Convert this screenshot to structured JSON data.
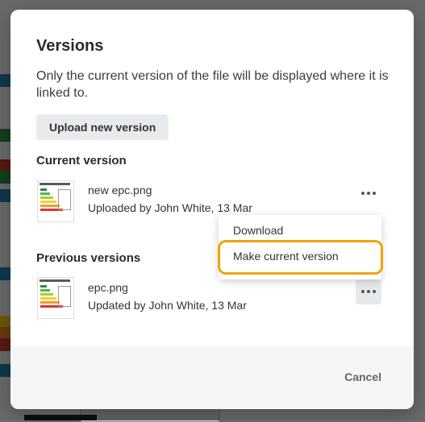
{
  "modal": {
    "title": "Versions",
    "description": "Only the current version of the file will be displayed where it is linked to.",
    "upload_button": "Upload new version",
    "current_section": "Current version",
    "previous_section": "Previous versions",
    "cancel_button": "Cancel"
  },
  "current_version": {
    "file_name": "new epc.png",
    "meta": "Uploaded by John White, 13 Mar",
    "thumbnail_icon": "epc-chart-thumbnail"
  },
  "previous_versions": [
    {
      "file_name": "epc.png",
      "meta": "Updated by John White, 13 Mar",
      "thumbnail_icon": "epc-chart-thumbnail"
    }
  ],
  "context_menu": {
    "items": [
      "Download",
      "Make current version"
    ],
    "highlighted_item": "Make current version"
  },
  "colors": {
    "highlight_outline": "#f0a30a",
    "overlay": "#6f6f6f",
    "footer_bg": "#f3f5f6"
  }
}
